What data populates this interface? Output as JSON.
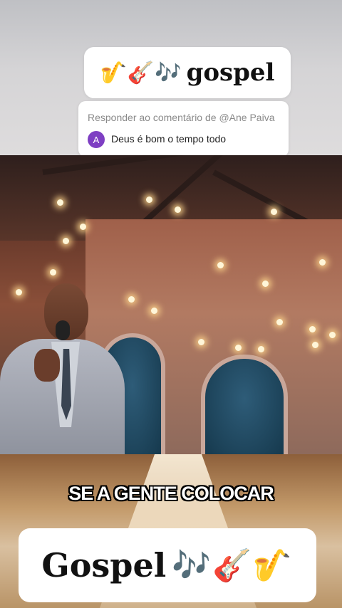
{
  "top_title": {
    "emojis": "🎷🎸🎶",
    "word": "gospel"
  },
  "reply": {
    "header": "Responder ao comentário de @Ane Paiva",
    "avatar_letter": "A",
    "avatar_color": "#7e3fc3",
    "text": "Deus é bom o tempo todo"
  },
  "caption": "SE A GENTE COLOCAR",
  "bottom_banner": {
    "word": "Gospel",
    "emojis": "🎶🎸🎷"
  }
}
